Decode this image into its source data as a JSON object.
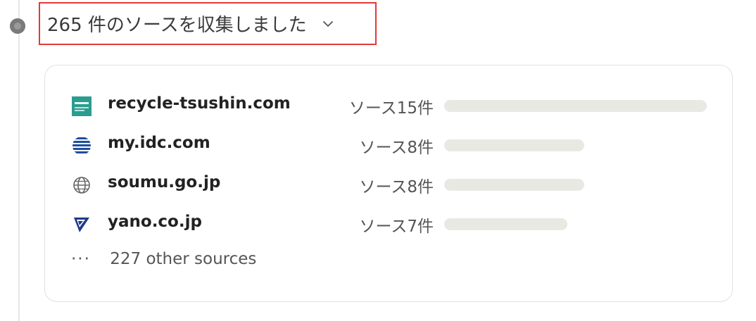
{
  "summary": {
    "label": "265 件のソースを収集しました",
    "chevron_icon": "chevron-down-icon"
  },
  "sources": [
    {
      "domain": "recycle-tsushin.com",
      "count_label": "ソース15件",
      "count": 15,
      "icon": "recycle-tsushin-logo-icon",
      "icon_color": "#2a9d8f"
    },
    {
      "domain": "my.idc.com",
      "count_label": "ソース8件",
      "count": 8,
      "icon": "idc-globe-logo-icon",
      "icon_color": "#1f4e9c"
    },
    {
      "domain": "soumu.go.jp",
      "count_label": "ソース8件",
      "count": 8,
      "icon": "globe-icon",
      "icon_color": "#666666"
    },
    {
      "domain": "yano.co.jp",
      "count_label": "ソース7件",
      "count": 7,
      "icon": "yano-logo-icon",
      "icon_color": "#1e3a8a"
    }
  ],
  "others": {
    "label": "227 other sources",
    "icon": "ellipsis-icon"
  }
}
